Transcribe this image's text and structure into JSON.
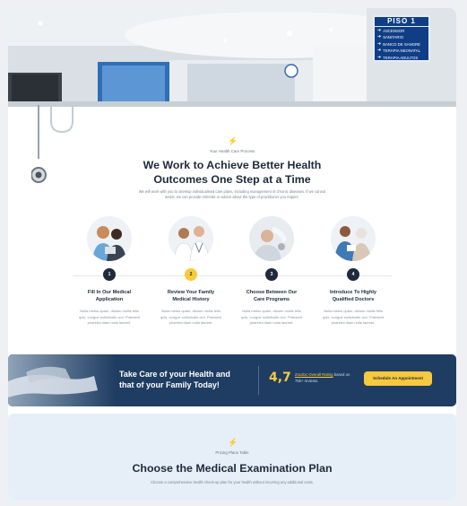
{
  "hero": {
    "sign": {
      "title": "PISO 1",
      "items": [
        "ASCENSOR",
        "SANITARIO",
        "BANCO DE SANGRE",
        "TERAPIA NEONATAL",
        "TERAPIA ADULTOS"
      ]
    }
  },
  "process": {
    "eyebrow": "Your Health Care Process",
    "headline_line1": "We Work to Achieve Better Health",
    "headline_line2": "Outcomes One Step at a Time",
    "lead_line1": "We will work with you to develop individualised care plans, including management of chronic diseases. If we cannot",
    "lead_line2": "assist, we can provide referrals or advice about the type of practitioner you require.",
    "steps": [
      {
        "num": "1",
        "title_line1": "Fill In Our Medical",
        "title_line2": "Application",
        "text_line1": "Nulla metus quam, dictum mollis felis",
        "text_line2": "quis, congue sollicitudin orci. Praesent",
        "text_line3": "pharetra diam nulla laoreet."
      },
      {
        "num": "2",
        "title_line1": "Review Your Family",
        "title_line2": "Medical History",
        "text_line1": "Nulla metus quam, dictum mollis felis",
        "text_line2": "quis, congue sollicitudin orci. Praesent",
        "text_line3": "pharetra diam nulla laoreet."
      },
      {
        "num": "3",
        "title_line1": "Choose Between Our",
        "title_line2": "Care Programs",
        "text_line1": "Nulla metus quam, dictum mollis felis",
        "text_line2": "quis, congue sollicitudin orci. Praesent",
        "text_line3": "pharetra diam nulla laoreet."
      },
      {
        "num": "4",
        "title_line1": "Introduce To Highly",
        "title_line2": "Qualified Doctors",
        "text_line1": "Nulla metus quam, dictum mollis felis",
        "text_line2": "quis, congue sollicitudin orci. Praesent",
        "text_line3": "pharetra diam nulla laoreet."
      }
    ]
  },
  "banner": {
    "headline_line1": "Take Care of your Health and",
    "headline_line2": "that of your Family Today!",
    "rating": "4,7",
    "rating_link": "Zocdoc Overall Rating",
    "rating_suffix": "based on",
    "rating_reviews": "75k+ reviews.",
    "button_label": "Schedule An Appointment"
  },
  "pricing": {
    "eyebrow": "Pricing Plans Table",
    "headline": "Choose the Medical Examination Plan",
    "lead": "Choose a comprehensive health check-up plan for your health without incurring any additional costs."
  },
  "colors": {
    "accent": "#f7c93e",
    "navy": "#1f3d63",
    "text": "#1d2b3a",
    "pricing_bg": "#e6eef8"
  }
}
